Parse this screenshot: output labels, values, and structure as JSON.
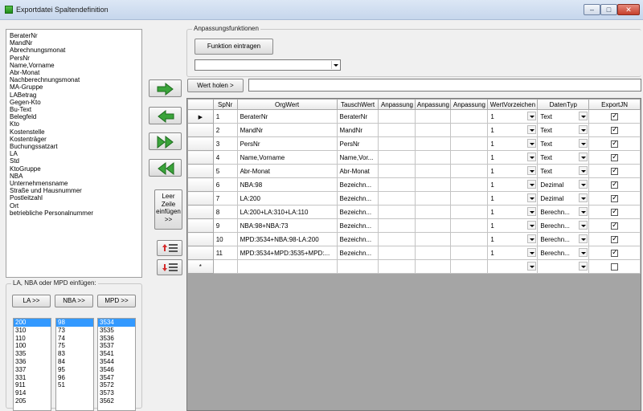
{
  "window": {
    "title": "Exportdatei Spaltendefinition",
    "min_glyph": "–",
    "max_glyph": "□",
    "close_glyph": "✕"
  },
  "field_list": [
    "BeraterNr",
    "MandNr",
    "Abrechnungsmonat",
    "PersNr",
    "Name,Vorname",
    "Abr-Monat",
    "Nachberechnungsmonat",
    "MA-Gruppe",
    "LABetrag",
    "Gegen-Kto",
    "Bu-Text",
    "Belegfeld",
    "Kto",
    "Kostenstelle",
    "Kostenträger",
    "Buchungssatzart",
    "LA",
    "Std",
    "KtoGruppe",
    "NBA",
    "Unternehmensname",
    "Straße und Hausnummer",
    "Postleitzahl",
    "Ort",
    "betriebliche Personalnummer"
  ],
  "insert_group": {
    "label": "LA, NBA oder MPD einfügen:",
    "la_button": "LA >>",
    "nba_button": "NBA >>",
    "mpd_button": "MPD >>",
    "la_values": [
      "200",
      "310",
      "110",
      "100",
      "335",
      "336",
      "337",
      "331",
      "911",
      "914",
      "205"
    ],
    "nba_values": [
      "98",
      "73",
      "74",
      "75",
      "83",
      "84",
      "95",
      "96",
      "51"
    ],
    "mpd_values": [
      "3534",
      "3535",
      "3536",
      "3537",
      "3541",
      "3544",
      "3546",
      "3547",
      "3572",
      "3573",
      "3562"
    ]
  },
  "buttons": {
    "add_icon": "arrow-right-icon",
    "remove_icon": "arrow-left-icon",
    "add_all_icon": "double-arrow-right-icon",
    "remove_all_icon": "double-arrow-left-icon",
    "empty_line_1": "Leer",
    "empty_line_2": "Zeile",
    "empty_line_3": "einfügen",
    "empty_line_4": ">>",
    "row_up_icon": "move-up-icon",
    "row_down_icon": "move-down-icon"
  },
  "func_group": {
    "label": "Anpassungsfunktionen",
    "insert_button": "Funktion eintragen",
    "select_value": ""
  },
  "wert_button": "Wert holen >",
  "wert_value": "",
  "grid": {
    "headers": [
      "SpNr",
      "OrgWert",
      "TauschWert",
      "Anpassung",
      "Anpassung",
      "Anpassung",
      "WertVorzeichen",
      "DatenTyp",
      "ExportJN"
    ],
    "current_row_marker": "▶",
    "new_row_marker": "*",
    "rows": [
      {
        "spnr": "1",
        "org": "BeraterNr",
        "tausch": "BeraterNr",
        "vz": "1",
        "typ": "Text",
        "export": true
      },
      {
        "spnr": "2",
        "org": "MandNr",
        "tausch": "MandNr",
        "vz": "1",
        "typ": "Text",
        "export": true
      },
      {
        "spnr": "3",
        "org": "PersNr",
        "tausch": "PersNr",
        "vz": "1",
        "typ": "Text",
        "export": true
      },
      {
        "spnr": "4",
        "org": "Name,Vorname",
        "tausch": "Name,Vor...",
        "vz": "1",
        "typ": "Text",
        "export": true
      },
      {
        "spnr": "5",
        "org": "Abr-Monat",
        "tausch": "Abr-Monat",
        "vz": "1",
        "typ": "Text",
        "export": true
      },
      {
        "spnr": "6",
        "org": "NBA:98",
        "tausch": "Bezeichn...",
        "vz": "1",
        "typ": "Dezimal",
        "export": true
      },
      {
        "spnr": "7",
        "org": "LA:200",
        "tausch": "Bezeichn...",
        "vz": "1",
        "typ": "Dezimal",
        "export": true
      },
      {
        "spnr": "8",
        "org": "LA:200+LA:310+LA:110",
        "tausch": "Bezeichn...",
        "vz": "1",
        "typ": "Berechn...",
        "export": true
      },
      {
        "spnr": "9",
        "org": "NBA:98+NBA:73",
        "tausch": "Bezeichn...",
        "vz": "1",
        "typ": "Berechn...",
        "export": true
      },
      {
        "spnr": "10",
        "org": "MPD:3534+NBA:98-LA:200",
        "tausch": "Bezeichn...",
        "vz": "1",
        "typ": "Berechn...",
        "export": true
      },
      {
        "spnr": "11",
        "org": "MPD:3534+MPD:3535+MPD:...",
        "tausch": "Bezeichn...",
        "vz": "1",
        "typ": "Berechn...",
        "export": true
      }
    ]
  }
}
